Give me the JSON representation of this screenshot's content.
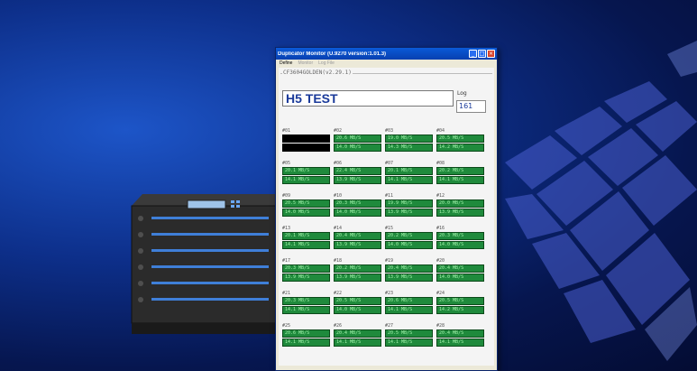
{
  "window": {
    "title": "Duplicator Monitor (U.9270 version:1.01.3)",
    "menu": [
      "Define",
      "Monitor",
      "Log File"
    ]
  },
  "group_label": "CF3604GOLDEN(v2.29.1)",
  "job_title": "H5 TEST",
  "log": {
    "label": "Log",
    "value": "161"
  },
  "ports": [
    {
      "num": "#01",
      "r1": "",
      "r2": "",
      "black": true
    },
    {
      "num": "#02",
      "r1": "20.6 MB/S",
      "r2": "14.0 MB/S"
    },
    {
      "num": "#03",
      "r1": "19.0 MB/S",
      "r2": "14.3 MB/S"
    },
    {
      "num": "#04",
      "r1": "20.5 MB/S",
      "r2": "14.2 MB/S"
    },
    {
      "num": "#05",
      "r1": "20.1 MB/S",
      "r2": "14.1 MB/S"
    },
    {
      "num": "#06",
      "r1": "22.4 MB/S",
      "r2": "13.9 MB/S"
    },
    {
      "num": "#07",
      "r1": "20.1 MB/S",
      "r2": "14.1 MB/S"
    },
    {
      "num": "#08",
      "r1": "20.2 MB/S",
      "r2": "14.1 MB/S"
    },
    {
      "num": "#09",
      "r1": "20.5 MB/S",
      "r2": "14.0 MB/S"
    },
    {
      "num": "#10",
      "r1": "20.3 MB/S",
      "r2": "14.0 MB/S"
    },
    {
      "num": "#11",
      "r1": "19.9 MB/S",
      "r2": "13.9 MB/S"
    },
    {
      "num": "#12",
      "r1": "20.0 MB/S",
      "r2": "13.9 MB/S"
    },
    {
      "num": "#13",
      "r1": "20.1 MB/S",
      "r2": "14.1 MB/S"
    },
    {
      "num": "#14",
      "r1": "20.4 MB/S",
      "r2": "13.9 MB/S"
    },
    {
      "num": "#15",
      "r1": "20.2 MB/S",
      "r2": "14.0 MB/S"
    },
    {
      "num": "#16",
      "r1": "20.3 MB/S",
      "r2": "14.0 MB/S"
    },
    {
      "num": "#17",
      "r1": "20.3 MB/S",
      "r2": "13.9 MB/S"
    },
    {
      "num": "#18",
      "r1": "20.2 MB/S",
      "r2": "13.9 MB/S"
    },
    {
      "num": "#19",
      "r1": "20.4 MB/S",
      "r2": "13.9 MB/S"
    },
    {
      "num": "#20",
      "r1": "20.4 MB/S",
      "r2": "14.0 MB/S"
    },
    {
      "num": "#21",
      "r1": "20.3 MB/S",
      "r2": "14.1 MB/S"
    },
    {
      "num": "#22",
      "r1": "20.5 MB/S",
      "r2": "14.0 MB/S"
    },
    {
      "num": "#23",
      "r1": "20.6 MB/S",
      "r2": "14.1 MB/S"
    },
    {
      "num": "#24",
      "r1": "20.5 MB/S",
      "r2": "14.2 MB/S"
    },
    {
      "num": "#25",
      "r1": "20.6 MB/S",
      "r2": "14.1 MB/S"
    },
    {
      "num": "#26",
      "r1": "20.4 MB/S",
      "r2": "14.1 MB/S"
    },
    {
      "num": "#27",
      "r1": "20.5 MB/S",
      "r2": "14.1 MB/S"
    },
    {
      "num": "#28",
      "r1": "20.4 MB/S",
      "r2": "14.1 MB/S"
    }
  ],
  "colors": {
    "port_ok": "#1f8a3c",
    "port_text": "#9ff0a8",
    "title_text": "#1a3a9a"
  }
}
